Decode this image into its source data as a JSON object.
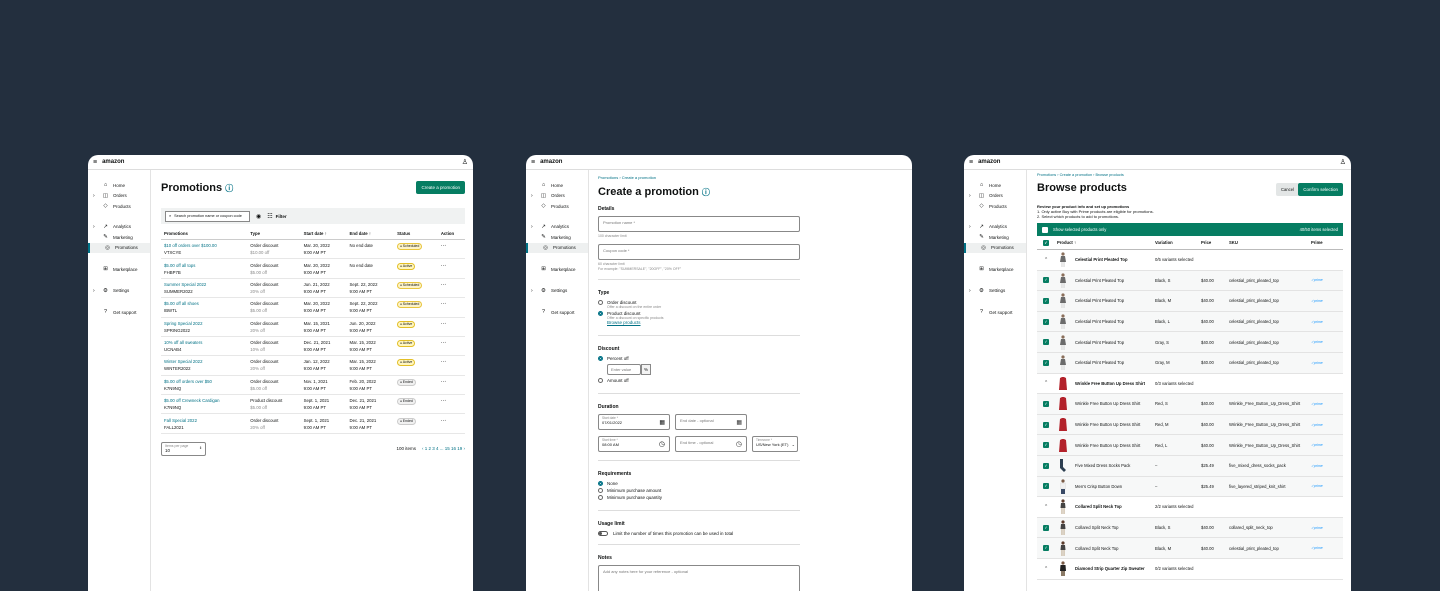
{
  "logo": "amazon",
  "nav": {
    "items": [
      {
        "label": "Home",
        "icon": "⌂",
        "caret": ""
      },
      {
        "label": "Orders",
        "icon": "◫",
        "caret": "›"
      },
      {
        "label": "Products",
        "icon": "◇",
        "caret": ""
      },
      {
        "label": "Analytics",
        "icon": "↗",
        "caret": "›"
      },
      {
        "label": "Marketing",
        "icon": "✎",
        "caret": ""
      },
      {
        "label": "Promotions",
        "icon": "◎",
        "caret": ""
      },
      {
        "label": "Marketplace",
        "icon": "⊞",
        "caret": ""
      },
      {
        "label": "Settings",
        "icon": "⚙",
        "caret": "›"
      },
      {
        "label": "Get support",
        "icon": "?",
        "caret": ""
      }
    ]
  },
  "promotions": {
    "title": "Promotions",
    "create_button": "Create a promotion",
    "search_placeholder": "Search promotion name or coupon code",
    "filter_label": "Filter",
    "columns": [
      "Promotions",
      "Type",
      "Start date ↑",
      "End date ↑",
      "Status",
      "Action"
    ],
    "rows": [
      {
        "name": "$10 off orders over $100.00",
        "code": "VTXCYE",
        "type": "Order discount",
        "type2": "$10.00 off",
        "start": "Mar. 20, 2022",
        "start2": "9:00 AM PT",
        "end": "No end date",
        "end2": "",
        "status": "Scheduled"
      },
      {
        "name": "$5.00 off all tops",
        "code": "FHBP7B",
        "type": "Order discount",
        "type2": "$5.00 off",
        "start": "Mar. 20, 2022",
        "start2": "9:00 AM PT",
        "end": "No end date",
        "end2": "",
        "status": "Active"
      },
      {
        "name": "Summer Special 2022",
        "code": "SUMMER2022",
        "type": "Order discount",
        "type2": "20% off",
        "start": "Jun. 21, 2022",
        "start2": "9:00 AM PT",
        "end": "Sept. 22, 2022",
        "end2": "9:00 AM PT",
        "status": "Scheduled"
      },
      {
        "name": "$5.00 off all shoes",
        "code": "IBWTL",
        "type": "Order discount",
        "type2": "$5.00 off",
        "start": "Mar. 20, 2022",
        "start2": "9:00 AM PT",
        "end": "Sept. 22, 2022",
        "end2": "9:00 AM PT",
        "status": "Scheduled"
      },
      {
        "name": "Spring Special 2022",
        "code": "SPRING2022",
        "type": "Order discount",
        "type2": "20% off",
        "start": "Mar. 15, 2021",
        "start2": "9:00 AM PT",
        "end": "Jun. 20, 2022",
        "end2": "9:00 AM PT",
        "status": "Active"
      },
      {
        "name": "10% off all sweaters",
        "code": "UCNAB4",
        "type": "Order discount",
        "type2": "10% off",
        "start": "Dec. 21, 2021",
        "start2": "9:00 AM PT",
        "end": "Mar. 15, 2022",
        "end2": "9:00 AM PT",
        "status": "Active"
      },
      {
        "name": "Winter Special 2022",
        "code": "WINTER2022",
        "type": "Order discount",
        "type2": "20% off",
        "start": "Jan. 12, 2022",
        "start2": "9:00 AM PT",
        "end": "Mar. 15, 2022",
        "end2": "9:00 AM PT",
        "status": "Active"
      },
      {
        "name": "$5.00 off orders over $50",
        "code": "K7N9NQ",
        "type": "Order discount",
        "type2": "$5.00 off",
        "start": "Nov. 1, 2021",
        "start2": "9:00 AM PT",
        "end": "Feb. 20, 2022",
        "end2": "9:00 AM PT",
        "status": "Ended"
      },
      {
        "name": "$5.00 off Crewneck Cardigan",
        "code": "K7N9NQ",
        "type": "Product discount",
        "type2": "$5.00 off",
        "start": "Sept. 1, 2021",
        "start2": "9:00 AM PT",
        "end": "Dec. 21, 2021",
        "end2": "9:00 AM PT",
        "status": "Ended"
      },
      {
        "name": "Fall Special 2022",
        "code": "FALL2021",
        "type": "Order discount",
        "type2": "20% off",
        "start": "Sept. 1, 2021",
        "start2": "9:00 AM PT",
        "end": "Dec. 21, 2021",
        "end2": "9:00 AM PT",
        "status": "Ended"
      }
    ],
    "items_per_page_label": "Items per page",
    "items_per_page": "10",
    "total_items": "100 items",
    "pagination": "‹  1  2  3  4 ... 15  16  19  ›"
  },
  "create": {
    "breadcrumb": "Promotions  ›  Create a promotion",
    "title": "Create a promotion",
    "details_label": "Details",
    "name_placeholder": "Promotion name *",
    "name_hint": "100 character limit",
    "coupon_placeholder": "Coupon code *",
    "coupon_hint": "60 character limit",
    "coupon_example": "For example: \"SUMMERSALE\", \"20OFF\", \"20% OFF\"",
    "type_label": "Type",
    "type_order": "Order discount",
    "type_order_desc": "Offer a discount on the entire order",
    "type_product": "Product discount",
    "type_product_desc": "Offer a discount on specific products",
    "browse_link": "Browse products",
    "discount_label": "Discount",
    "percent_off": "Percent off",
    "value_placeholder": "Enter value",
    "percent_suffix": "%",
    "amount_off": "Amount off",
    "duration_label": "Duration",
    "start_date_label": "Start date *",
    "start_date": "07/01/2022",
    "end_date_placeholder": "End date - optional",
    "start_time_label": "Start time *",
    "start_time": "08:00 AM",
    "end_time_placeholder": "End time - optional",
    "timezone_label": "Timezone *",
    "timezone": "US/New York (ET)",
    "requirements_label": "Requirements",
    "req_none": "None",
    "req_amount": "Minimum purchase amount",
    "req_qty": "Minimum purchase quantity",
    "usage_label": "Usage limit",
    "usage_text": "Limit the number of times this promotion can be used in total",
    "notes_label": "Notes",
    "notes_placeholder": "Add any notes here for your reference - optional"
  },
  "browse": {
    "breadcrumb": "Promotions  ›  Create a promotion  ›  Browse products",
    "title": "Browse products",
    "cancel": "Cancel",
    "confirm": "Confirm selection",
    "instructions_title": "Review your product info and set up promotions",
    "instr1": "1. Only active Buy with Prime products are eligible for promotions.",
    "instr2": "2. Select which products to add to promotions.",
    "show_selected": "Show selected products only",
    "selected_count": "40/50 items selected",
    "columns": [
      "Product ↑",
      "Variation",
      "Price",
      "SKU",
      "Prime"
    ],
    "prime": "✓prime",
    "rows": [
      {
        "kind": "group",
        "name": "Celestial Print Pleated Top",
        "variation": "0/5 variants selected",
        "price": "",
        "sku": "",
        "img": "top"
      },
      {
        "kind": "item",
        "name": "Celestial Print Pleated Top",
        "variation": "Black, S",
        "price": "$40.00",
        "sku": "celestial_print_pleated_top",
        "img": "top"
      },
      {
        "kind": "item",
        "name": "Celestial Print Pleated Top",
        "variation": "Black, M",
        "price": "$40.00",
        "sku": "celestial_print_pleated_top",
        "img": "top"
      },
      {
        "kind": "item",
        "name": "Celestial Print Pleated Top",
        "variation": "Black, L",
        "price": "$40.00",
        "sku": "celestial_print_pleated_top",
        "img": "top"
      },
      {
        "kind": "item",
        "name": "Celestial Print Pleated Top",
        "variation": "Gray, S",
        "price": "$40.00",
        "sku": "celestial_print_pleated_top",
        "img": "top"
      },
      {
        "kind": "item",
        "name": "Celestial Print Pleated Top",
        "variation": "Gray, M",
        "price": "$40.00",
        "sku": "celestial_print_pleated_top",
        "img": "top"
      },
      {
        "kind": "group",
        "name": "Wrinkle Free Button Up Dress Shirt",
        "variation": "0/3 variants selected",
        "price": "",
        "sku": "",
        "img": "shirt"
      },
      {
        "kind": "item",
        "name": "Wrinkle Free Button Up Dress Shirt",
        "variation": "Red, S",
        "price": "$40.00",
        "sku": "Wrinkle_Free_Button_Up_Dress_Shirt",
        "img": "shirt"
      },
      {
        "kind": "item",
        "name": "Wrinkle Free Button Up Dress Shirt",
        "variation": "Red, M",
        "price": "$40.00",
        "sku": "Wrinkle_Free_Button_Up_Dress_Shirt",
        "img": "shirt"
      },
      {
        "kind": "item",
        "name": "Wrinkle Free Button Up Dress Shirt",
        "variation": "Red, L",
        "price": "$40.00",
        "sku": "Wrinkle_Free_Button_Up_Dress_Shirt",
        "img": "shirt"
      },
      {
        "kind": "single",
        "name": "Five Mixed Dress Socks Pack",
        "variation": "–",
        "price": "$25.49",
        "sku": "five_mixed_dress_socks_pack",
        "img": "socks"
      },
      {
        "kind": "single",
        "name": "Men's Crisp Button Down",
        "variation": "–",
        "price": "$25.49",
        "sku": "five_layered_striped_knit_shirt",
        "img": "man"
      },
      {
        "kind": "group",
        "name": "Collared Split Neck Top",
        "variation": "2/2 variants selected",
        "price": "",
        "sku": "",
        "img": "woman"
      },
      {
        "kind": "item",
        "name": "Collared Split Neck Top",
        "variation": "Black, S",
        "price": "$40.00",
        "sku": "collared_split_neck_top",
        "img": "woman"
      },
      {
        "kind": "item",
        "name": "Collared Split Neck Top",
        "variation": "Black, M",
        "price": "$40.00",
        "sku": "celestial_print_pleated_top",
        "img": "woman"
      },
      {
        "kind": "group",
        "name": "Diamond Strip Quarter Zip Sweater",
        "variation": "0/2 variants selected",
        "price": "",
        "sku": "",
        "img": "sweater"
      }
    ]
  }
}
